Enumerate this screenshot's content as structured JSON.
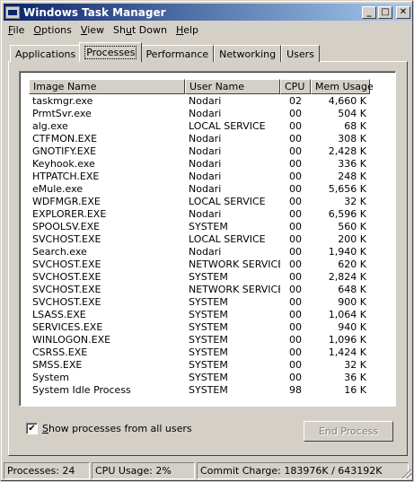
{
  "window": {
    "title": "Windows Task Manager"
  },
  "menu": [
    {
      "label": "File",
      "key": "F",
      "rest": "ile"
    },
    {
      "label": "Options",
      "key": "O",
      "rest": "ptions"
    },
    {
      "label": "View",
      "key": "V",
      "rest": "iew"
    },
    {
      "label": "Shut Down",
      "key": "",
      "pre": "Sh",
      "mid": "u",
      "post": "t Down"
    },
    {
      "label": "Help",
      "key": "H",
      "rest": "elp"
    }
  ],
  "tabs": [
    "Applications",
    "Processes",
    "Performance",
    "Networking",
    "Users"
  ],
  "active_tab": "Processes",
  "table": {
    "columns": [
      "Image Name",
      "User Name",
      "CPU",
      "Mem Usage"
    ],
    "rows": [
      [
        "taskmgr.exe",
        "Nodari",
        "02",
        "4,660 K"
      ],
      [
        "PrmtSvr.exe",
        "Nodari",
        "00",
        "504 K"
      ],
      [
        "alg.exe",
        "LOCAL SERVICE",
        "00",
        "68 K"
      ],
      [
        "CTFMON.EXE",
        "Nodari",
        "00",
        "308 K"
      ],
      [
        "GNOTIFY.EXE",
        "Nodari",
        "00",
        "2,428 K"
      ],
      [
        "Keyhook.exe",
        "Nodari",
        "00",
        "336 K"
      ],
      [
        "HTPATCH.EXE",
        "Nodari",
        "00",
        "248 K"
      ],
      [
        "eMule.exe",
        "Nodari",
        "00",
        "5,656 K"
      ],
      [
        "WDFMGR.EXE",
        "LOCAL SERVICE",
        "00",
        "32 K"
      ],
      [
        "EXPLORER.EXE",
        "Nodari",
        "00",
        "6,596 K"
      ],
      [
        "SPOOLSV.EXE",
        "SYSTEM",
        "00",
        "560 K"
      ],
      [
        "SVCHOST.EXE",
        "LOCAL SERVICE",
        "00",
        "200 K"
      ],
      [
        "Search.exe",
        "Nodari",
        "00",
        "1,940 K"
      ],
      [
        "SVCHOST.EXE",
        "NETWORK SERVICE",
        "00",
        "620 K"
      ],
      [
        "SVCHOST.EXE",
        "SYSTEM",
        "00",
        "2,824 K"
      ],
      [
        "SVCHOST.EXE",
        "NETWORK SERVICE",
        "00",
        "648 K"
      ],
      [
        "SVCHOST.EXE",
        "SYSTEM",
        "00",
        "900 K"
      ],
      [
        "LSASS.EXE",
        "SYSTEM",
        "00",
        "1,064 K"
      ],
      [
        "SERVICES.EXE",
        "SYSTEM",
        "00",
        "940 K"
      ],
      [
        "WINLOGON.EXE",
        "SYSTEM",
        "00",
        "1,096 K"
      ],
      [
        "CSRSS.EXE",
        "SYSTEM",
        "00",
        "1,424 K"
      ],
      [
        "SMSS.EXE",
        "SYSTEM",
        "00",
        "32 K"
      ],
      [
        "System",
        "SYSTEM",
        "00",
        "36 K"
      ],
      [
        "System Idle Process",
        "SYSTEM",
        "98",
        "16 K"
      ]
    ]
  },
  "show_all_users": {
    "label": "Show processes from all users",
    "key": "S",
    "rest": "how processes from all users",
    "checked": true
  },
  "end_process_label": "End Process",
  "status": {
    "processes": "Processes: 24",
    "cpu": "CPU Usage: 2%",
    "commit": "Commit Charge: 183976K / 643192K"
  },
  "icons": {
    "minimize": "minimize-icon",
    "maximize": "maximize-icon",
    "close": "close-icon",
    "app": "task-manager-icon"
  },
  "colors": {
    "title_start": "#0a246a",
    "title_end": "#a6caf0",
    "face": "#d4d0c8"
  }
}
